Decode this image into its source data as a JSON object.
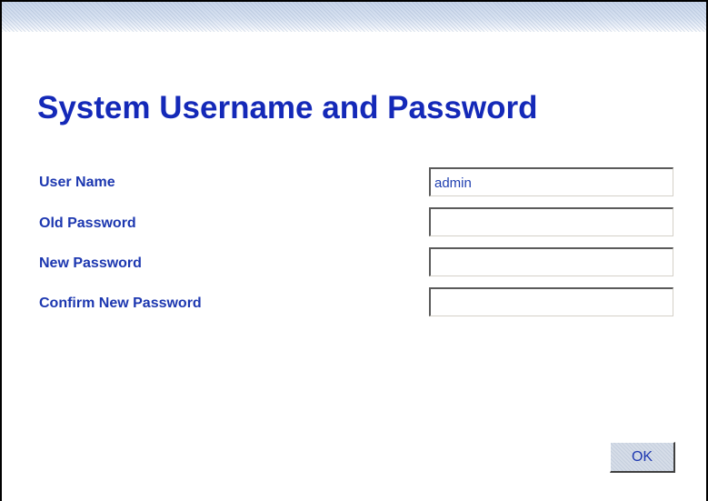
{
  "page": {
    "title": "System Username and Password"
  },
  "form": {
    "fields": [
      {
        "label": "User Name",
        "value": "admin"
      },
      {
        "label": "Old Password",
        "value": ""
      },
      {
        "label": "New Password",
        "value": ""
      },
      {
        "label": "Confirm New Password",
        "value": ""
      }
    ],
    "ok_label": "OK"
  },
  "colors": {
    "title": "#1429b8",
    "label": "#1c37b0",
    "header_band": "#c9d6ea"
  }
}
